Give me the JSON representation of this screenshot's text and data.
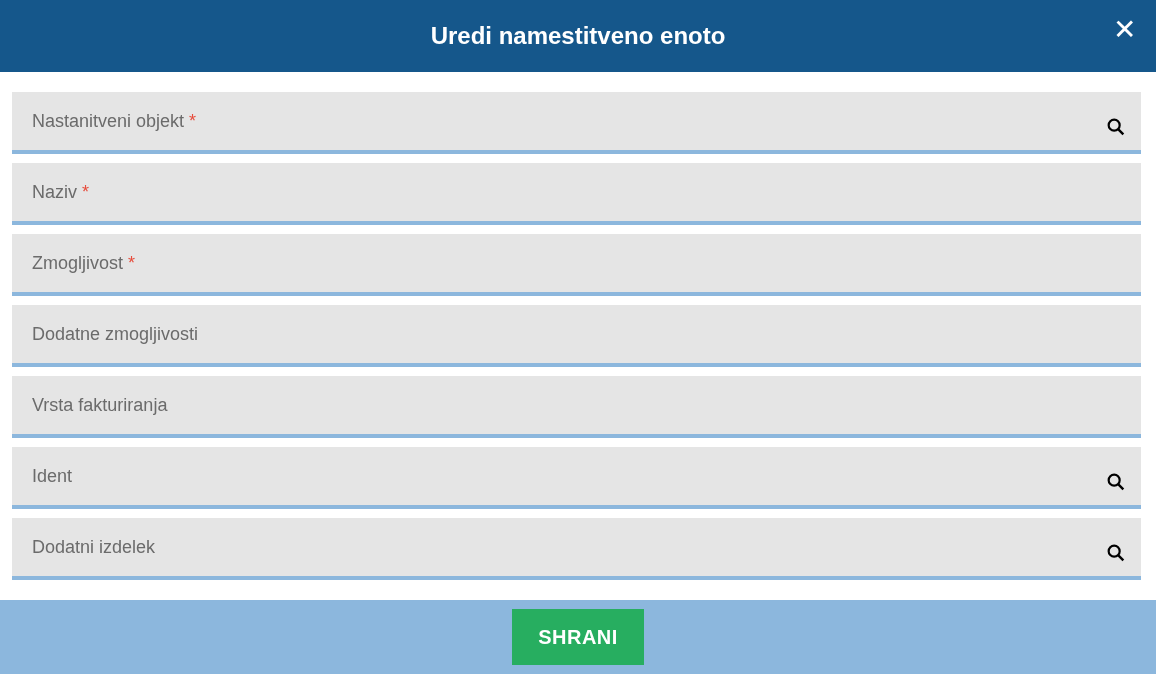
{
  "dialog": {
    "title": "Uredi namestitveno enoto",
    "close": "✕"
  },
  "fields": [
    {
      "kind": "lookup",
      "label": "Nastanitveni objekt",
      "required_mark": "*"
    },
    {
      "kind": "text",
      "label": "Naziv",
      "required_mark": "*"
    },
    {
      "kind": "text",
      "label": "Zmogljivost",
      "required_mark": "*"
    },
    {
      "kind": "text",
      "label": "Dodatne zmogljivosti"
    },
    {
      "kind": "text",
      "label": "Vrsta fakturiranja"
    },
    {
      "kind": "lookup",
      "label": "Ident"
    },
    {
      "kind": "lookup",
      "label": "Dodatni izdelek"
    }
  ],
  "footer": {
    "save_button": "SHRANI"
  }
}
